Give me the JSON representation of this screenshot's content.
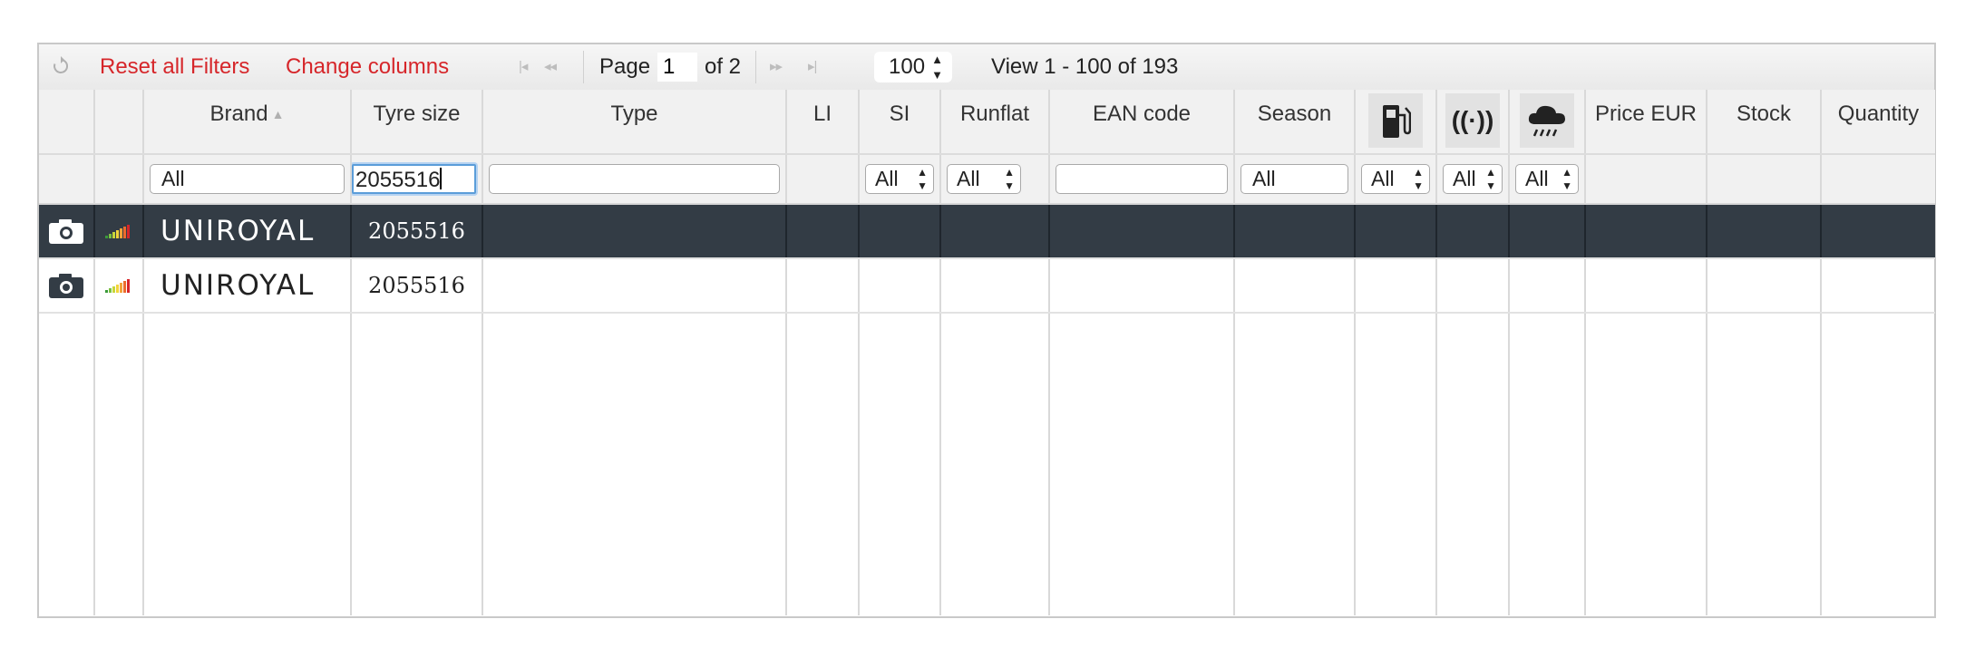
{
  "toolbar": {
    "reset_filters": "Reset all Filters",
    "change_columns": "Change columns",
    "page_label": "Page",
    "page_value": "1",
    "page_of": "of 2",
    "rows_per_page": "100",
    "view_text": "View 1 - 100 of 193",
    "icons": [
      "refresh-icon",
      "first-page-icon",
      "prev-page-icon",
      "next-page-icon",
      "last-page-icon"
    ]
  },
  "columns": {
    "brand": "Brand",
    "tyre_size": "Tyre size",
    "type": "Type",
    "li": "LI",
    "si": "SI",
    "runflat": "Runflat",
    "ean": "EAN code",
    "season": "Season",
    "fuel_icon": "fuel-pump-icon",
    "noise_icon": "noise-waves-icon",
    "wet_icon": "rain-cloud-icon",
    "price": "Price EUR",
    "stock": "Stock",
    "quantity": "Quantity"
  },
  "filters": {
    "brand": "All",
    "tyre_size": "2055516",
    "type": "",
    "si": "All",
    "runflat": "All",
    "ean": "",
    "season": "All",
    "fuel": "All",
    "noise": "All",
    "wet": "All"
  },
  "rows": [
    {
      "brand": "UNIROYAL",
      "size": "2055516",
      "selected": true
    },
    {
      "brand": "UNIROYAL",
      "size": "2055516",
      "selected": false
    }
  ],
  "colors": {
    "selected_row": "#333c45",
    "link_red": "#d6262a",
    "focus_blue": "#5b9dd9"
  }
}
